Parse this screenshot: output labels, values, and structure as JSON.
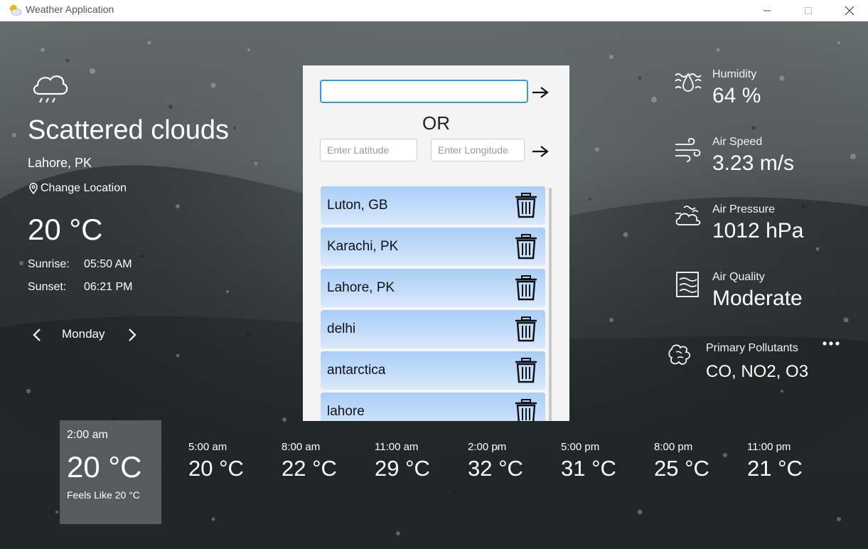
{
  "window": {
    "title": "Weather Application",
    "controls": [
      "minimize",
      "maximize",
      "close"
    ]
  },
  "current": {
    "condition": "Scattered clouds",
    "city": "Lahore, PK",
    "change_location": "Change Location",
    "temperature": "20 °C",
    "sunrise_label": "Sunrise:",
    "sunrise": "05:50 AM",
    "sunset_label": "Sunset:",
    "sunset": "06:21 PM",
    "day": "Monday"
  },
  "search": {
    "city_value": "",
    "or_label": "OR",
    "lat_placeholder": "Enter Latitude",
    "lon_placeholder": "Enter Longitude"
  },
  "saved_locations": [
    {
      "name": "Luton, GB"
    },
    {
      "name": "Karachi, PK"
    },
    {
      "name": "Lahore, PK"
    },
    {
      "name": "delhi"
    },
    {
      "name": "antarctica"
    },
    {
      "name": "lahore"
    }
  ],
  "stats": {
    "humidity": {
      "label": "Humidity",
      "value": "64 %"
    },
    "air_speed": {
      "label": "Air Speed",
      "value": "3.23 m/s"
    },
    "air_pressure": {
      "label": "Air Pressure",
      "value": "1012 hPa"
    },
    "air_quality": {
      "label": "Air Quality",
      "value": "Moderate"
    },
    "pollutants": {
      "label": "Primary Pollutants",
      "value": "CO, NO2, O3"
    }
  },
  "hourly": {
    "selected": {
      "time": "2:00 am",
      "temp": "20 °C",
      "feels": "Feels Like 20 °C"
    },
    "items": [
      {
        "time": "5:00 am",
        "temp": "20 °C"
      },
      {
        "time": "8:00 am",
        "temp": "22 °C"
      },
      {
        "time": "11:00 am",
        "temp": "29 °C"
      },
      {
        "time": "2:00 pm",
        "temp": "32 °C"
      },
      {
        "time": "5:00 pm",
        "temp": "31 °C"
      },
      {
        "time": "8:00 pm",
        "temp": "25 °C"
      },
      {
        "time": "11:00 pm",
        "temp": "21 °C"
      }
    ]
  },
  "colors": {
    "accent_input_border": "#3a9ad9",
    "list_item_top": "#aacdf6",
    "list_item_bottom": "#dce9fb",
    "panel_bg": "#f4f4f4"
  }
}
